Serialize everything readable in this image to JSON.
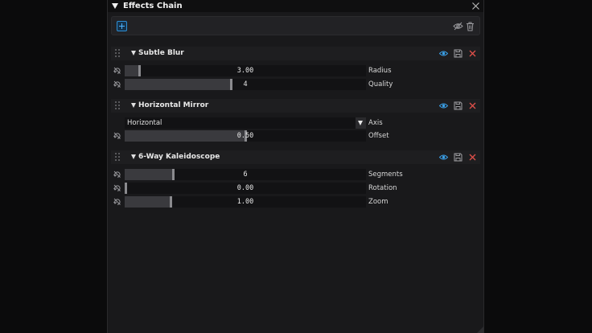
{
  "panel": {
    "title": "Effects Chain"
  },
  "colors": {
    "accent": "#2d8fd6",
    "eye": "#3aa0e8",
    "close": "#e0504a"
  },
  "effects": [
    {
      "name": "Subtle Blur",
      "params": [
        {
          "label": "Radius",
          "value": "3.00",
          "fill": 0.06
        },
        {
          "label": "Quality",
          "value": "4",
          "fill": 0.44
        }
      ]
    },
    {
      "name": "Horizontal Mirror",
      "axis": {
        "label": "Axis",
        "value": "Horizontal"
      },
      "params": [
        {
          "label": "Offset",
          "value": "0.50",
          "fill": 0.5
        }
      ]
    },
    {
      "name": "6-Way Kaleidoscope",
      "params": [
        {
          "label": "Segments",
          "value": "6",
          "fill": 0.2
        },
        {
          "label": "Rotation",
          "value": "0.00",
          "fill": 0.0
        },
        {
          "label": "Zoom",
          "value": "1.00",
          "fill": 0.19
        }
      ]
    }
  ]
}
